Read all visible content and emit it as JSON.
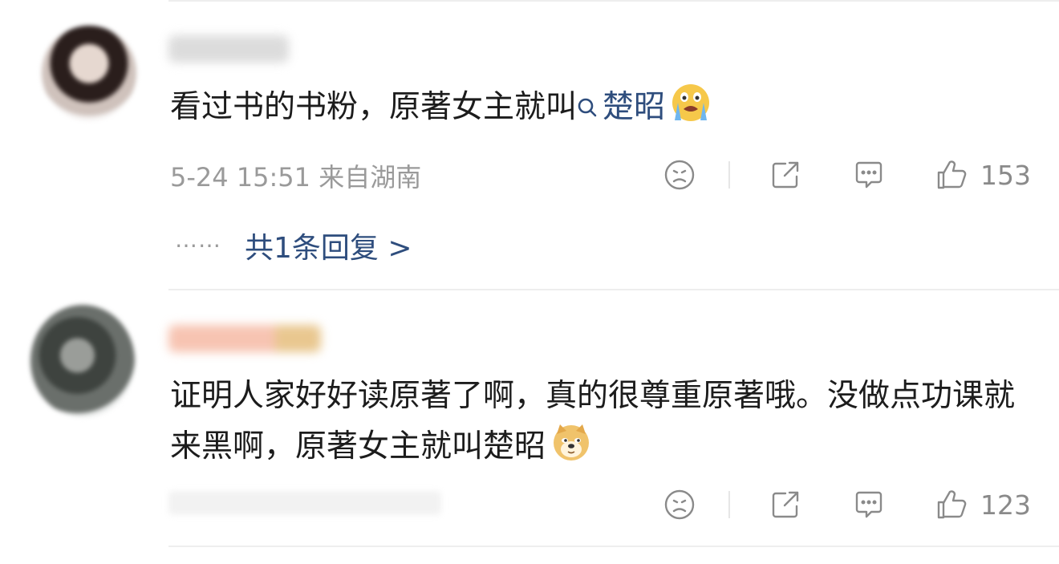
{
  "comments": [
    {
      "text_before": "看过书的书粉，原著女主就叫",
      "search_link": "楚昭",
      "emoji": "crying-emoji",
      "time": "5-24 15:51",
      "location": "来自湖南",
      "likes": "153",
      "reply_summary": "共1条回复 >",
      "reply_dots": "……"
    },
    {
      "text": "证明人家好好读原著了啊，真的很尊重原著哦。没做点功课就来黑啊，原著女主就叫楚昭",
      "emoji": "doge-emoji",
      "likes": "123"
    }
  ],
  "colors": {
    "link": "#2e4d7d",
    "meta": "#9a9a9a",
    "icon": "#8a8a8a",
    "divider": "#eeeeee"
  }
}
